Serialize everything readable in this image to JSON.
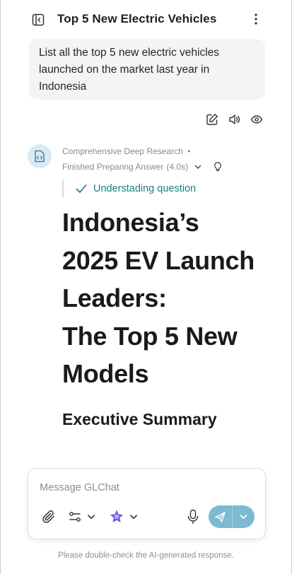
{
  "header": {
    "title": "Top 5 New Electric Vehicles",
    "left_icon": "sidebar-toggle-icon",
    "right_icon": "more-vertical-icon"
  },
  "user_message": {
    "text": "List all the top 5 new electric vehicles launched on the market last year in Indonesia",
    "actions": [
      "edit-icon",
      "speaker-icon",
      "eye-icon"
    ]
  },
  "assistant": {
    "avatar_icon": "code-file-icon",
    "mode": "Comprehensive Deep Research",
    "separator": "•",
    "status": "Finished Preparing Answer",
    "duration": "(4.0s)",
    "step": "Understading question",
    "report_title_lines": [
      "Indonesia’s",
      "2025 EV Launch",
      "Leaders:",
      "The Top 5 New",
      "Models"
    ],
    "section_heading": "Executive Summary"
  },
  "composer": {
    "placeholder": "Message GLChat",
    "tools": [
      "paperclip-icon",
      "settings-sliders-icon",
      "model-selector-icon",
      "microphone-icon"
    ],
    "send_icon": "send-icon"
  },
  "footer": {
    "disclaimer": "Please double-check the AI-generated response."
  },
  "colors": {
    "accent": "#7cb9d3",
    "step_text": "#1a7f86",
    "avatar_bg": "#d6ebf5",
    "model_icon": "#6b4de6"
  }
}
